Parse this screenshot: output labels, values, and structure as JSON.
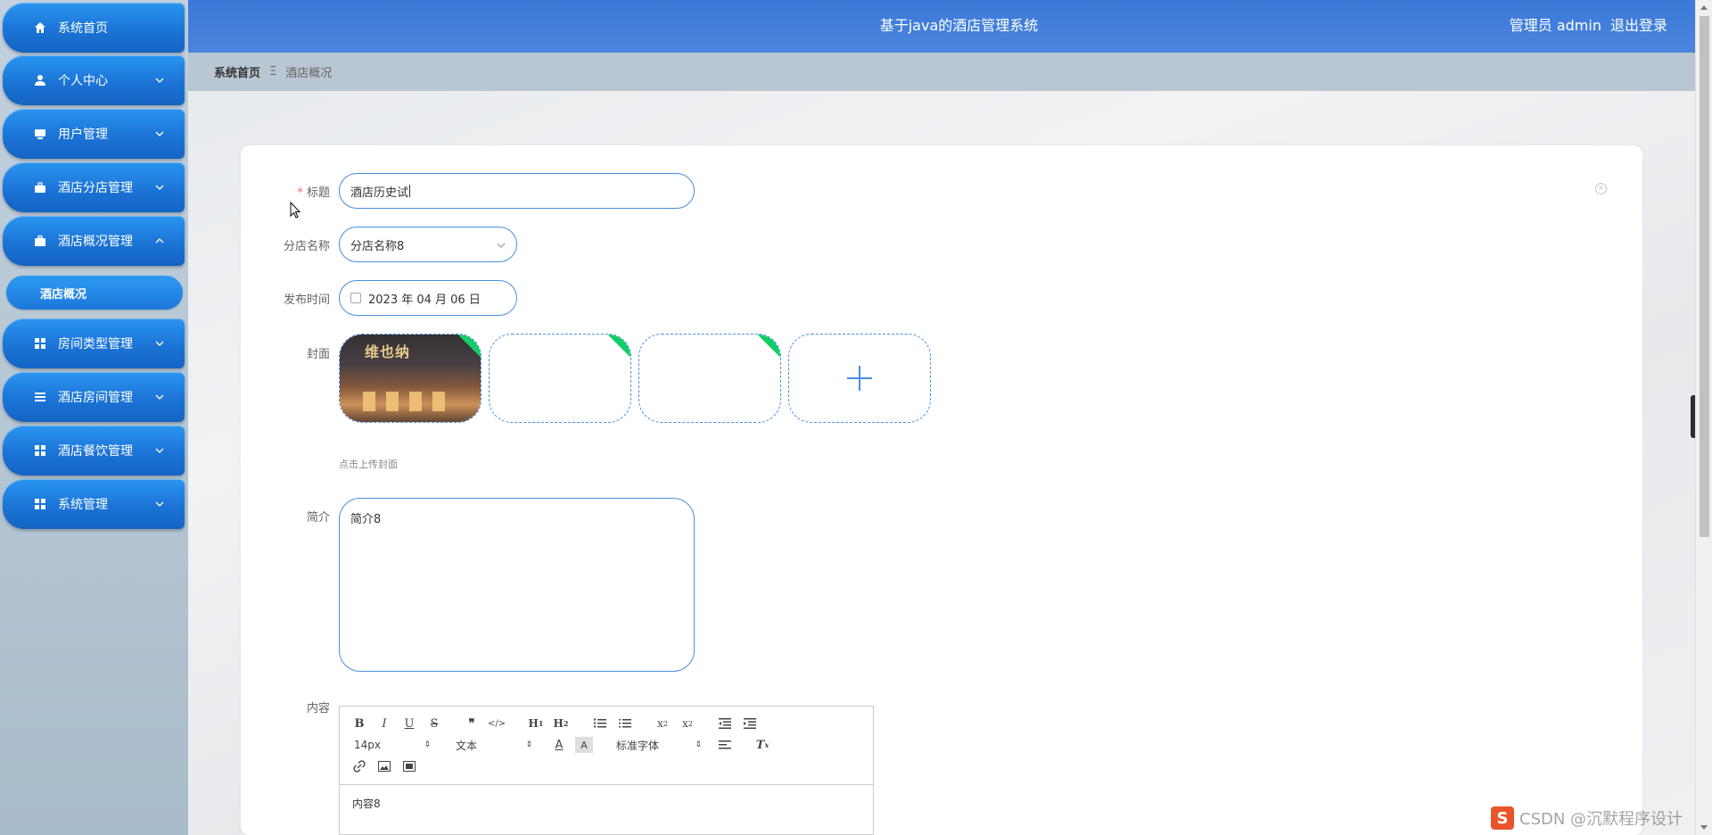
{
  "sidebar": {
    "items": [
      {
        "label": "系统首页",
        "icon": "home-icon",
        "has_chevron": false
      },
      {
        "label": "个人中心",
        "icon": "person-icon",
        "has_chevron": true,
        "chevron": "down"
      },
      {
        "label": "用户管理",
        "icon": "monitor-icon",
        "has_chevron": true,
        "chevron": "down"
      },
      {
        "label": "酒店分店管理",
        "icon": "briefcase-icon",
        "has_chevron": true,
        "chevron": "down"
      },
      {
        "label": "酒店概况管理",
        "icon": "briefcase-icon",
        "has_chevron": true,
        "chevron": "up"
      },
      {
        "label": "房间类型管理",
        "icon": "grid-icon",
        "has_chevron": true,
        "chevron": "down"
      },
      {
        "label": "酒店房间管理",
        "icon": "list-icon",
        "has_chevron": true,
        "chevron": "down"
      },
      {
        "label": "酒店餐饮管理",
        "icon": "grid-icon",
        "has_chevron": true,
        "chevron": "down"
      },
      {
        "label": "系统管理",
        "icon": "grid-icon",
        "has_chevron": true,
        "chevron": "down"
      }
    ],
    "active_sub": "酒店概况"
  },
  "header": {
    "title": "基于java的酒店管理系统",
    "user_label": "管理员 admin",
    "logout_label": "退出登录"
  },
  "breadcrumb": {
    "home": "系统首页",
    "separator": "Ξ",
    "current": "酒店概况"
  },
  "form": {
    "title_label": "标题",
    "title_value": "酒店历史试",
    "branch_label": "分店名称",
    "branch_value": "分店名称8",
    "date_label": "发布时间",
    "date_value": "2023 年 04 月 06 日",
    "cover_label": "封面",
    "cover_image_text": "维也纳",
    "cover_hint": "点击上传封面",
    "intro_label": "简介",
    "intro_value": "简介8",
    "content_label": "内容",
    "content_value": "内容8"
  },
  "editor": {
    "font_size": "14px",
    "text_type": "文本",
    "font_family": "标准字体"
  },
  "watermark": {
    "logo": "S",
    "text": "CSDN @沉默程序设计"
  },
  "colors": {
    "accent": "#1b74d6",
    "header": "#3b78d8",
    "input_border": "#4a8ee0",
    "required": "#f56c6c",
    "upload_success": "#13ce66"
  }
}
